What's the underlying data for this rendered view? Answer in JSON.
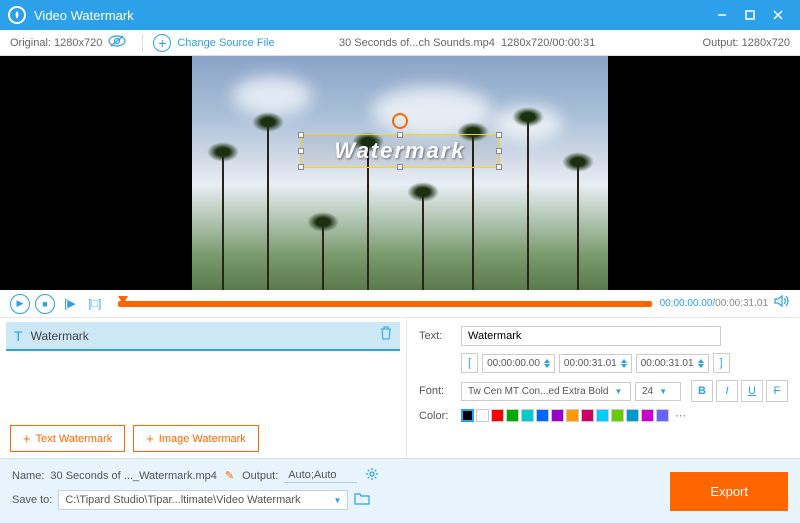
{
  "app": {
    "title": "Video Watermark"
  },
  "toolbar": {
    "original_label": "Original:",
    "original_res": "1280x720",
    "change_source": "Change Source File",
    "file_name": "30 Seconds of...ch Sounds.mp4",
    "file_info": "1280x720/00:00:31",
    "output_label": "Output:",
    "output_res": "1280x720"
  },
  "preview": {
    "watermark_text": "Watermark"
  },
  "player": {
    "current": "00:00:00.00",
    "duration": "00:00:31.01"
  },
  "watermark_list": {
    "item_label": "Watermark",
    "text_btn": "Text Watermark",
    "image_btn": "Image Watermark"
  },
  "props": {
    "text_label": "Text:",
    "text_value": "Watermark",
    "time_start": "00:00:00.00",
    "time_end": "00:00:31.01",
    "time_dur": "00:00:31.01",
    "font_label": "Font:",
    "font_name": "Tw Cen MT Con...ed Extra Bold",
    "font_size": "24",
    "color_label": "Color:",
    "colors": [
      "#000000",
      "#ffffff",
      "#ff0000",
      "#00aa00",
      "#00cccc",
      "#0066ff",
      "#9900cc",
      "#ff9900",
      "#cc0066",
      "#00ccff",
      "#66cc00",
      "#0099cc",
      "#cc00cc",
      "#6666ff"
    ]
  },
  "bottom": {
    "name_label": "Name:",
    "name_value": "30 Seconds of ..._Watermark.mp4",
    "output_label": "Output:",
    "output_value": "Auto;Auto",
    "save_label": "Save to:",
    "save_path": "C:\\Tipard Studio\\Tipar...ltimate\\Video Watermark",
    "export": "Export"
  }
}
